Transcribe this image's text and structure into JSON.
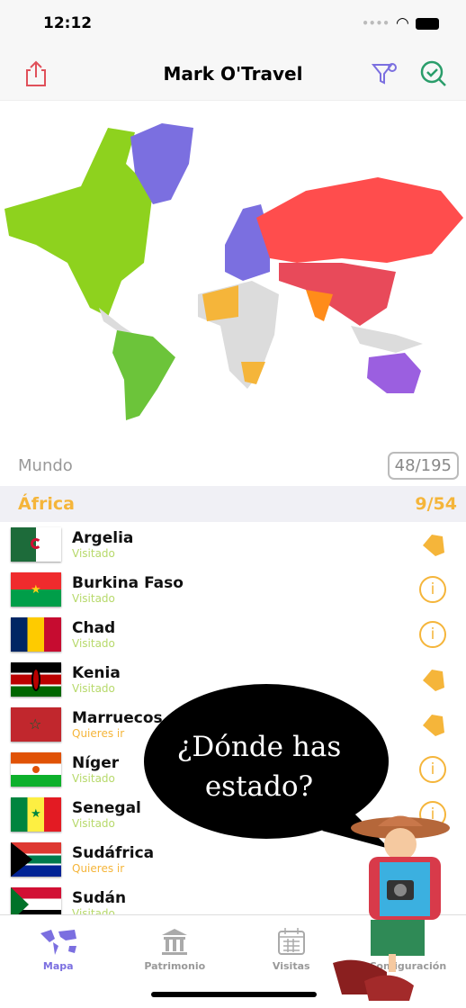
{
  "status_bar": {
    "time": "12:12"
  },
  "header": {
    "title": "Mark O'Travel",
    "share_icon": "share-icon",
    "filter_icon": "filter-settings-icon",
    "check_icon": "search-check-icon"
  },
  "map": {
    "colors": {
      "north_america": "#8ed21e",
      "greenland": "#7b6fe0",
      "south_america": "#6cc43a",
      "europe": "#7b6fe0",
      "russia": "#ff4d4d",
      "africa_visited": "#f5b53a",
      "australia": "#9b5fe0",
      "unvisited": "#dcdcdc"
    }
  },
  "world": {
    "label": "Mundo",
    "count": "48/195"
  },
  "section": {
    "label": "África",
    "count": "9/54"
  },
  "countries": [
    {
      "name": "Argelia",
      "status": "Visitado",
      "icon": "country-shape"
    },
    {
      "name": "Burkina Faso",
      "status": "Visitado",
      "icon": "info"
    },
    {
      "name": "Chad",
      "status": "Visitado",
      "icon": "info"
    },
    {
      "name": "Kenia",
      "status": "Visitado",
      "icon": "country-shape"
    },
    {
      "name": "Marruecos",
      "status": "Quieres ir",
      "icon": "country-shape"
    },
    {
      "name": "Níger",
      "status": "Visitado",
      "icon": "info"
    },
    {
      "name": "Senegal",
      "status": "Visitado",
      "icon": "info"
    },
    {
      "name": "Sudáfrica",
      "status": "Quieres ir",
      "icon": "none"
    },
    {
      "name": "Sudán",
      "status": "Visitado",
      "icon": "none"
    }
  ],
  "info_glyph": "i",
  "bubble": {
    "line1": "¿Dónde has",
    "line2": "estado?"
  },
  "tabs": [
    {
      "label": "Mapa",
      "active": true
    },
    {
      "label": "Patrimonio"
    },
    {
      "label": "Visitas"
    },
    {
      "label": "Configuración"
    }
  ],
  "accent": "#7b6fe0",
  "visited_color": "#b7d96b",
  "want_color": "#f5b53a"
}
